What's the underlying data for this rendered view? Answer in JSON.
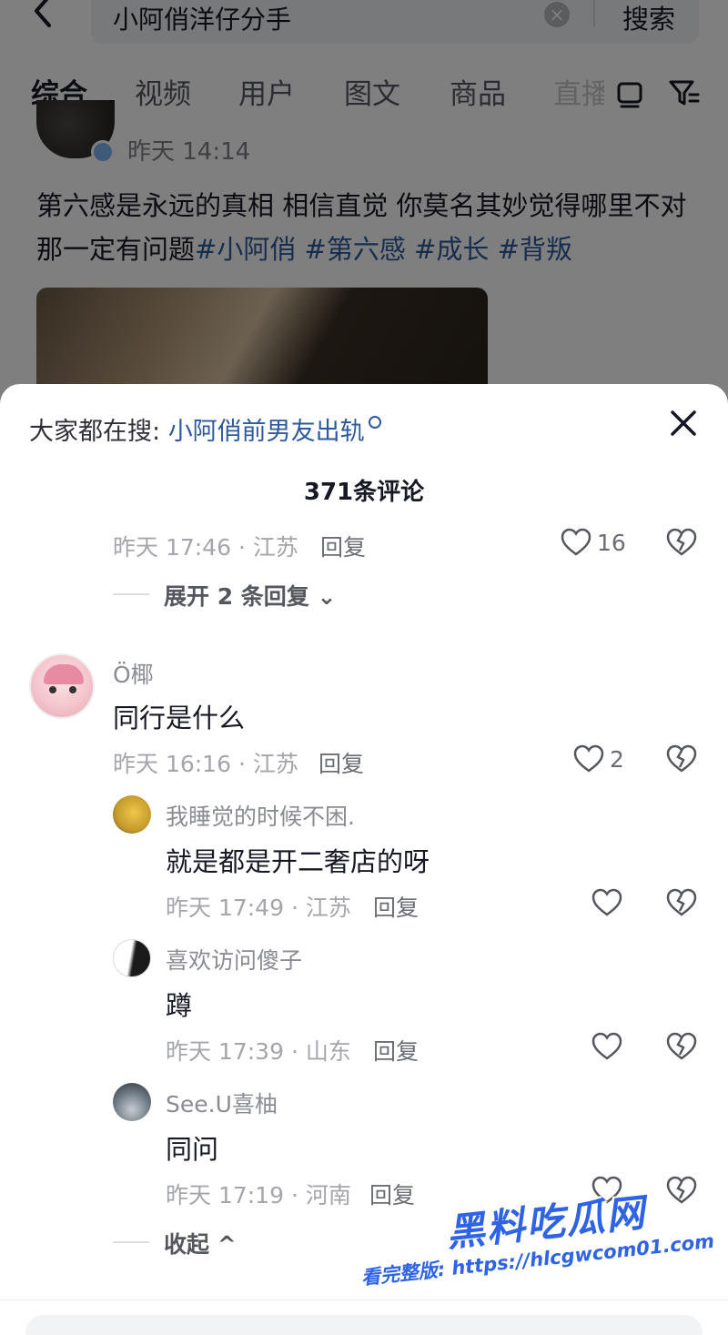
{
  "search": {
    "query": "小阿俏洋仔分手",
    "button_label": "搜索"
  },
  "tabs": [
    "综合",
    "视频",
    "用户",
    "图文",
    "商品",
    "直播"
  ],
  "post": {
    "time": "昨天 14:14",
    "text": "第六感是永远的真相 相信直觉 你莫名其妙觉得哪里不对那一定有问题",
    "hashtags": [
      "#小阿俏",
      "#第六感",
      "#成长",
      "#背叛"
    ]
  },
  "sheet": {
    "hot_prefix": "大家都在搜: ",
    "hot_link": "小阿俏前男友出轨",
    "comment_count": "371条评论",
    "reply_label": "回复",
    "top_comment": {
      "meta": "昨天 17:46 · 江苏",
      "likes": "16",
      "expand": "展开 2 条回复"
    },
    "comment": {
      "username": "Ö椰",
      "content": "同行是什么",
      "meta": "昨天 16:16 · 江苏",
      "likes": "2",
      "replies": [
        {
          "username": "我睡觉的时候不困.",
          "content": "就是都是开二奢店的呀",
          "meta": "昨天 17:49 · 江苏"
        },
        {
          "username": "喜欢访问傻子",
          "content": "蹲",
          "meta": "昨天 17:39 · 山东"
        },
        {
          "username": "See.U喜柚",
          "content": "同问",
          "meta": "昨天 17:19 · 河南"
        }
      ],
      "collapse": "收起"
    }
  },
  "watermark": {
    "title": "黑料吃瓜网",
    "url": "看完整版: https://hlcgwcom01.com"
  },
  "colors": {
    "link": "#2e5a9c",
    "watermark": "#2f63e6"
  }
}
